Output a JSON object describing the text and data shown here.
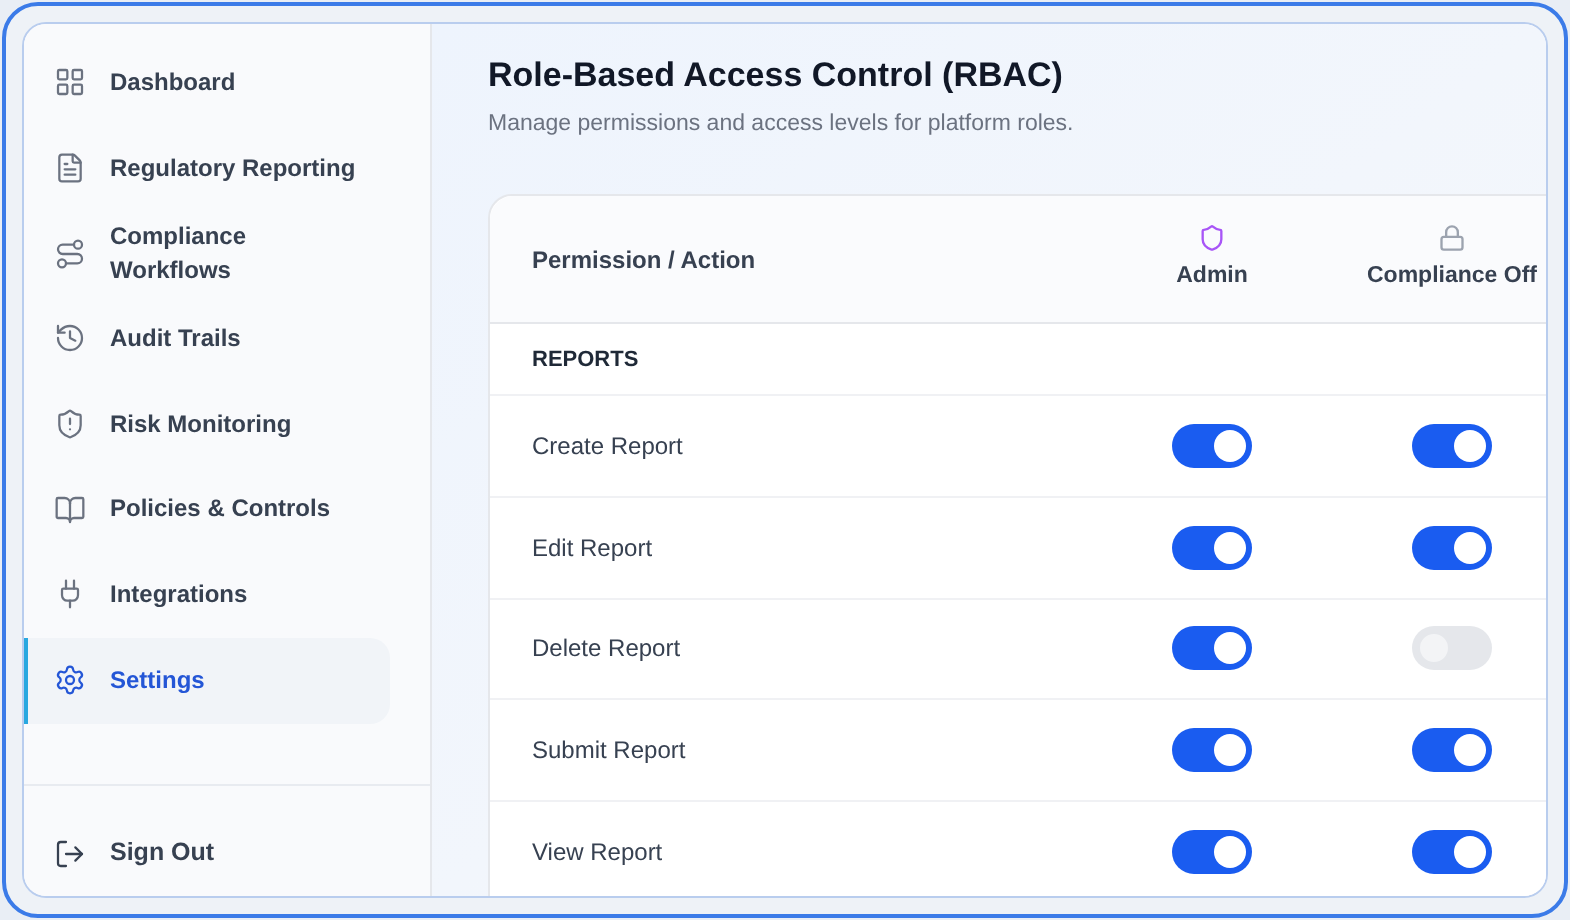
{
  "sidebar": {
    "items": [
      {
        "label": "Dashboard",
        "kind": "grid",
        "selected": false
      },
      {
        "label": "Regulatory Reporting",
        "kind": "file",
        "selected": false
      },
      {
        "label": "Compliance Workflows",
        "kind": "route",
        "selected": false
      },
      {
        "label": "Audit Trails",
        "kind": "history",
        "selected": false
      },
      {
        "label": "Risk Monitoring",
        "kind": "shield",
        "selected": false
      },
      {
        "label": "Policies & Controls",
        "kind": "book",
        "selected": false
      },
      {
        "label": "Integrations",
        "kind": "plug",
        "selected": false
      },
      {
        "label": "Settings",
        "kind": "settings",
        "selected": true
      }
    ],
    "sign_out": "Sign Out"
  },
  "page": {
    "title": "Role-Based Access Control (RBAC)",
    "subtitle": "Manage permissions and access levels for platform roles."
  },
  "table": {
    "columns": [
      {
        "label": "Permission / Action"
      },
      {
        "label": "Admin",
        "kind": "shield"
      },
      {
        "label": "Compliance Off",
        "kind": "lock"
      }
    ],
    "sections": [
      {
        "title": "REPORTS",
        "rows": [
          {
            "label": "Create Report",
            "admin": true,
            "compliance": true
          },
          {
            "label": "Edit Report",
            "admin": true,
            "compliance": true
          },
          {
            "label": "Delete Report",
            "admin": true,
            "compliance": false
          },
          {
            "label": "Submit Report",
            "admin": true,
            "compliance": true
          },
          {
            "label": "View Report",
            "admin": true,
            "compliance": true
          }
        ]
      }
    ]
  }
}
